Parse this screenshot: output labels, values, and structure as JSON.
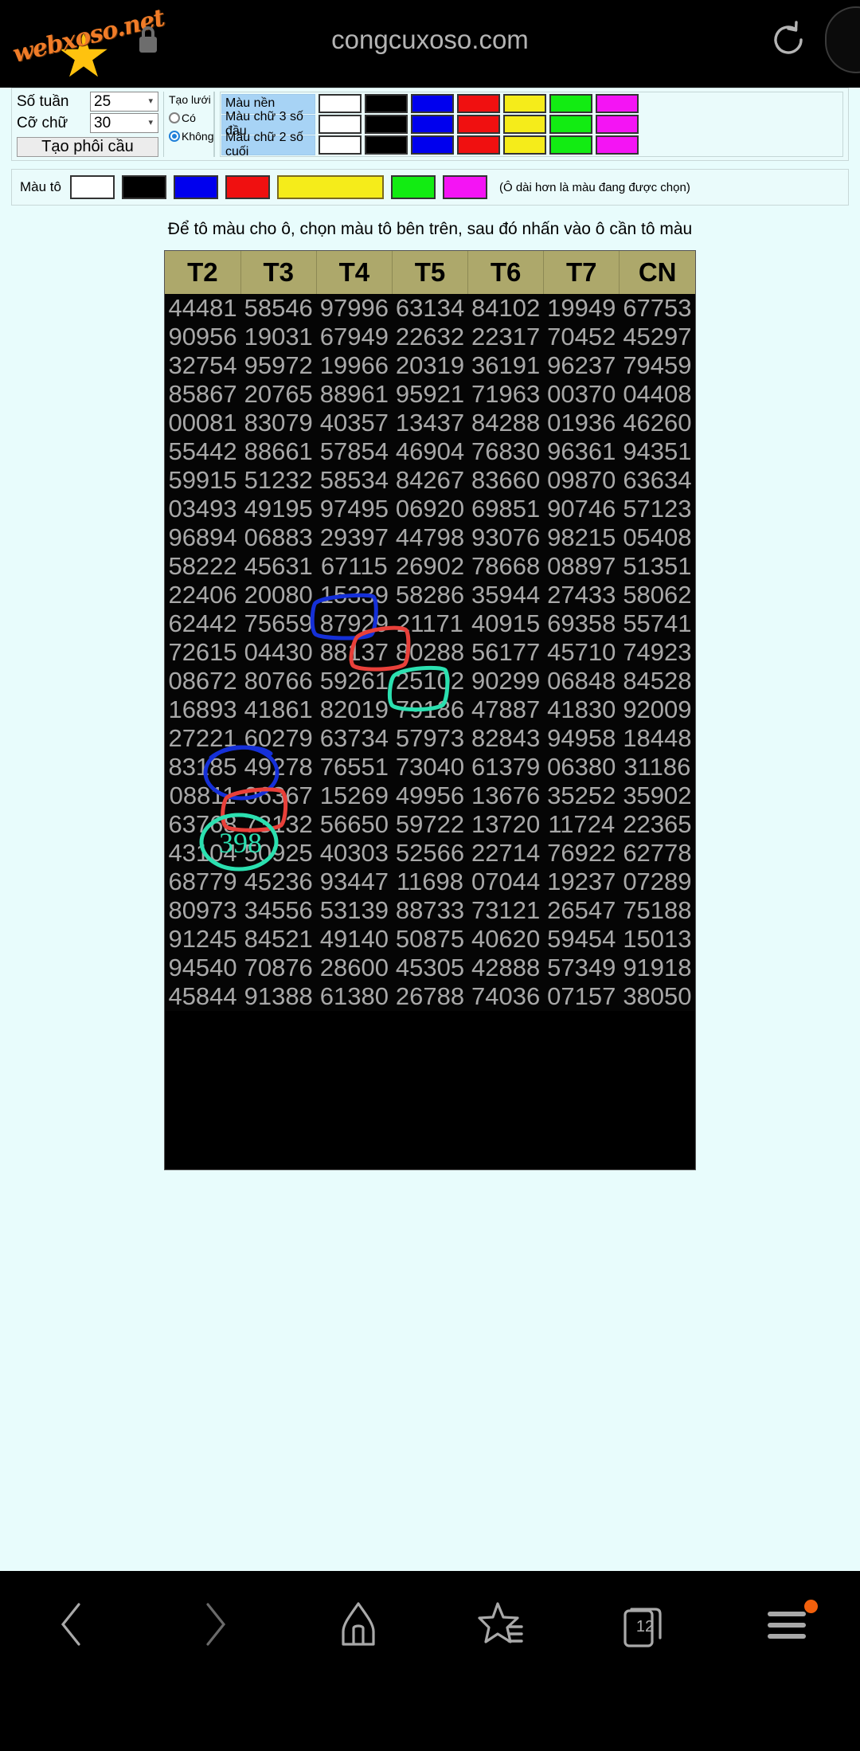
{
  "browser": {
    "logo_text": "webxoso.net",
    "url_title": "congcuxoso.com",
    "lock_icon": "lock-icon",
    "reload_icon": "reload-icon"
  },
  "controls": {
    "weeks_label": "Số tuần",
    "weeks_value": "25",
    "fontsize_label": "Cỡ chữ",
    "fontsize_value": "30",
    "generate_button": "Tạo phôi cầu",
    "grid_title": "Tạo lưới",
    "grid_yes": "Có",
    "grid_no": "Không",
    "grid_selected": "Không",
    "color_rows": [
      {
        "label": "Màu nền",
        "swatches": [
          "#FFFFFF",
          "#000000",
          "#0000EE",
          "#F01010",
          "#F5EC1A",
          "#12EC12",
          "#F414F4"
        ]
      },
      {
        "label": "Màu chữ 3 số đầu",
        "swatches": [
          "#FFFFFF",
          "#000000",
          "#0000EE",
          "#F01010",
          "#F5EC1A",
          "#12EC12",
          "#F414F4"
        ]
      },
      {
        "label": "Màu chữ 2 số cuối",
        "swatches": [
          "#FFFFFF",
          "#000000",
          "#0000EE",
          "#F01010",
          "#F5EC1A",
          "#12EC12",
          "#F414F4"
        ]
      }
    ]
  },
  "fill_bar": {
    "label": "Màu tô",
    "swatches": [
      "#FFFFFF",
      "#000000",
      "#0000EE",
      "#F01010",
      "#F5EC1A",
      "#12EC12",
      "#F414F4"
    ],
    "selected_index": 4,
    "note": "(Ô dài hơn là màu đang được chọn)"
  },
  "hint": "Để tô màu cho ô, chọn màu tô bên trên, sau đó nhấn vào ô cần tô màu",
  "chart_data": {
    "type": "table",
    "title": "",
    "columns": [
      "T2",
      "T3",
      "T4",
      "T5",
      "T6",
      "T7",
      "CN"
    ],
    "rows": [
      [
        "44481",
        "58546",
        "97996",
        "63134",
        "84102",
        "19949",
        "67753"
      ],
      [
        "90956",
        "19031",
        "67949",
        "22632",
        "22317",
        "70452",
        "45297"
      ],
      [
        "32754",
        "95972",
        "19966",
        "20319",
        "36191",
        "96237",
        "79459"
      ],
      [
        "85867",
        "20765",
        "88961",
        "95921",
        "71963",
        "00370",
        "04408"
      ],
      [
        "00081",
        "83079",
        "40357",
        "13437",
        "84288",
        "01936",
        "46260"
      ],
      [
        "55442",
        "88661",
        "57854",
        "46904",
        "76830",
        "96361",
        "94351"
      ],
      [
        "59915",
        "51232",
        "58534",
        "84267",
        "83660",
        "09870",
        "63634"
      ],
      [
        "03493",
        "49195",
        "97495",
        "06920",
        "69851",
        "90746",
        "57123"
      ],
      [
        "96894",
        "06883",
        "29397",
        "44798",
        "93076",
        "98215",
        "05408"
      ],
      [
        "58222",
        "45631",
        "67115",
        "26902",
        "78668",
        "08897",
        "51351"
      ],
      [
        "22406",
        "20080",
        "15339",
        "58286",
        "35944",
        "27433",
        "58062"
      ],
      [
        "62442",
        "75659",
        "87929",
        "21171",
        "40915",
        "69358",
        "55741"
      ],
      [
        "72615",
        "04430",
        "88137",
        "80288",
        "56177",
        "45710",
        "74923"
      ],
      [
        "08672",
        "80766",
        "59261",
        "25102",
        "90299",
        "06848",
        "84528"
      ],
      [
        "16893",
        "41861",
        "82019",
        "79186",
        "47887",
        "41830",
        "92009"
      ],
      [
        "27221",
        "60279",
        "63734",
        "57973",
        "82843",
        "94958",
        "18448"
      ],
      [
        "83185",
        "49278",
        "76551",
        "73040",
        "61379",
        "06380",
        "31186"
      ],
      [
        "08811",
        "06367",
        "15269",
        "49956",
        "13676",
        "35252",
        "35902"
      ],
      [
        "63768",
        "73132",
        "56650",
        "59722",
        "13720",
        "11724",
        "22365"
      ],
      [
        "43104",
        "50925",
        "40303",
        "52566",
        "22714",
        "76922",
        "62778"
      ],
      [
        "68779",
        "45236",
        "93447",
        "11698",
        "07044",
        "19237",
        "07289"
      ],
      [
        "80973",
        "34556",
        "53139",
        "88733",
        "73121",
        "26547",
        "75188"
      ],
      [
        "91245",
        "84521",
        "49140",
        "50875",
        "40620",
        "59454",
        "15013"
      ],
      [
        "94540",
        "70876",
        "28600",
        "45305",
        "42888",
        "57349",
        "91918"
      ],
      [
        "45844",
        "91388",
        "61380",
        "26788",
        "74036",
        "07157",
        "38050"
      ]
    ]
  },
  "annotations": {
    "handwritten_note": "398",
    "marks": [
      {
        "name": "blue-box-50925-40303",
        "color": "#1530D8"
      },
      {
        "name": "red-box-93447",
        "color": "#E8403A"
      },
      {
        "name": "teal-box-53139-88733",
        "color": "#2BE0B0"
      },
      {
        "name": "blue-circle-94540",
        "color": "#1530D8"
      },
      {
        "name": "red-box-45844",
        "color": "#E8403A"
      },
      {
        "name": "teal-circle-398",
        "color": "#2BE0B0"
      }
    ]
  },
  "bottom_nav": {
    "items": [
      {
        "name": "back-icon",
        "label": ""
      },
      {
        "name": "forward-icon",
        "label": ""
      },
      {
        "name": "home-icon",
        "label": ""
      },
      {
        "name": "bookmarks-icon",
        "label": ""
      },
      {
        "name": "tabs-icon",
        "label": "12"
      },
      {
        "name": "menu-icon",
        "label": ""
      }
    ],
    "tab_count": "12"
  }
}
